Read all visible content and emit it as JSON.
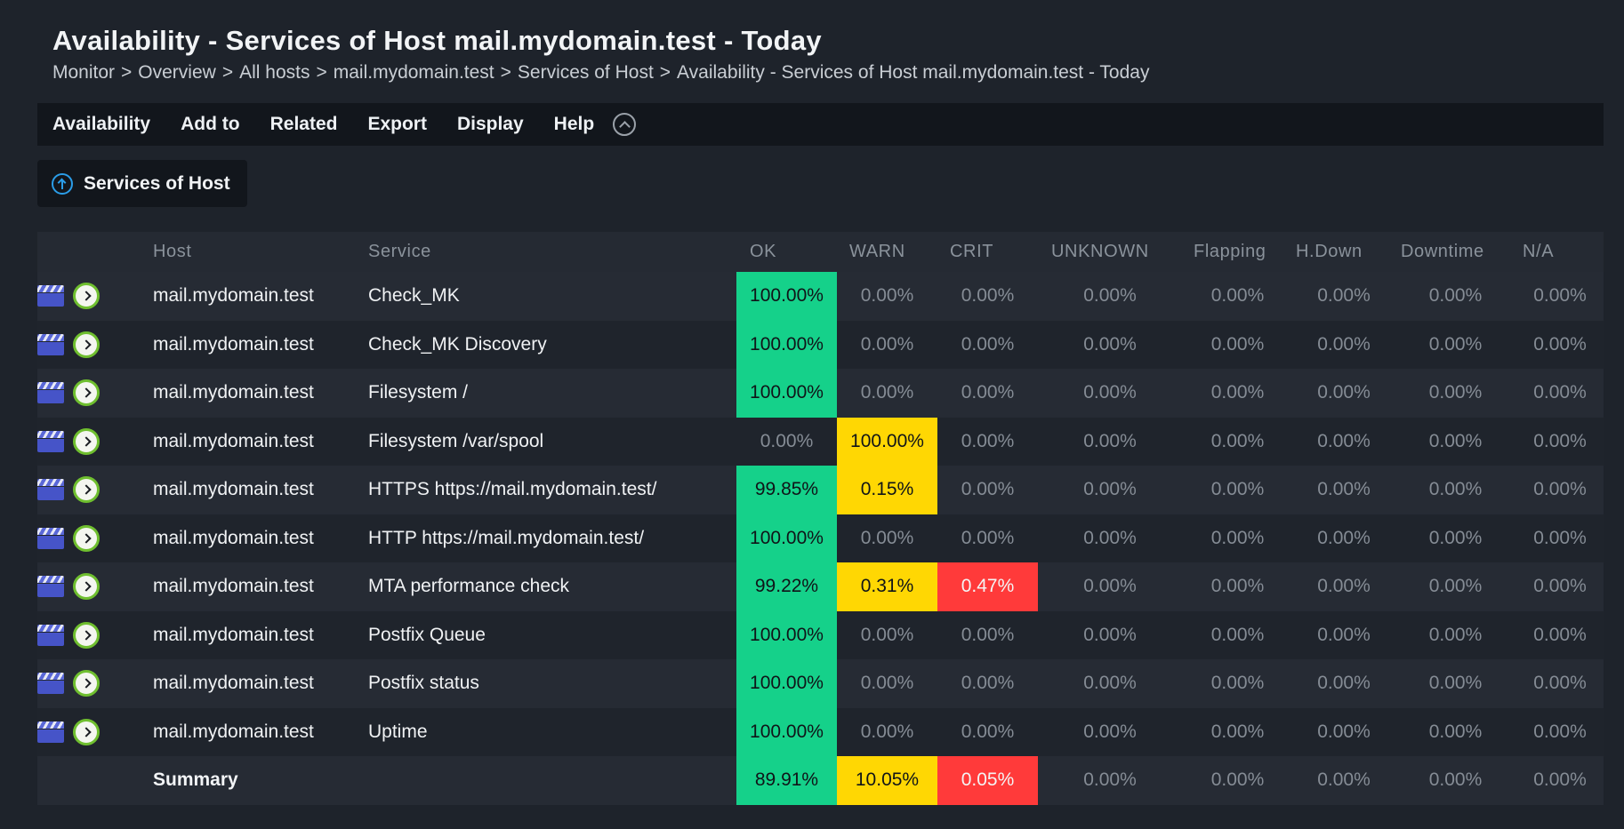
{
  "page": {
    "title": "Availability - Services of Host mail.mydomain.test - Today",
    "breadcrumb": [
      "Monitor",
      "Overview",
      "All hosts",
      "mail.mydomain.test",
      "Services of Host",
      "Availability - Services of Host mail.mydomain.test - Today"
    ],
    "breadcrumb_separator": ">"
  },
  "menubar": {
    "items": [
      "Availability",
      "Add to",
      "Related",
      "Export",
      "Display",
      "Help"
    ],
    "collapse_icon": "chevron-up-circle-icon"
  },
  "context_button": {
    "label": "Services of Host",
    "icon": "arrow-up-circle-icon"
  },
  "colors": {
    "ok": "#15d18a",
    "warn": "#ffd703",
    "crit": "#ff3a3a"
  },
  "table": {
    "columns": [
      "",
      "Host",
      "Service",
      "OK",
      "WARN",
      "CRIT",
      "UNKNOWN",
      "Flapping",
      "H.Down",
      "Downtime",
      "N/A"
    ],
    "rows": [
      {
        "host": "mail.mydomain.test",
        "service": "Check_MK",
        "ok": "100.00%",
        "warn": "0.00%",
        "crit": "0.00%",
        "unknown": "0.00%",
        "flapping": "0.00%",
        "hdown": "0.00%",
        "downtime": "0.00%",
        "na": "0.00%"
      },
      {
        "host": "mail.mydomain.test",
        "service": "Check_MK Discovery",
        "ok": "100.00%",
        "warn": "0.00%",
        "crit": "0.00%",
        "unknown": "0.00%",
        "flapping": "0.00%",
        "hdown": "0.00%",
        "downtime": "0.00%",
        "na": "0.00%"
      },
      {
        "host": "mail.mydomain.test",
        "service": "Filesystem /",
        "ok": "100.00%",
        "warn": "0.00%",
        "crit": "0.00%",
        "unknown": "0.00%",
        "flapping": "0.00%",
        "hdown": "0.00%",
        "downtime": "0.00%",
        "na": "0.00%"
      },
      {
        "host": "mail.mydomain.test",
        "service": "Filesystem /var/spool",
        "ok": "0.00%",
        "warn": "100.00%",
        "crit": "0.00%",
        "unknown": "0.00%",
        "flapping": "0.00%",
        "hdown": "0.00%",
        "downtime": "0.00%",
        "na": "0.00%"
      },
      {
        "host": "mail.mydomain.test",
        "service": "HTTPS https://mail.mydomain.test/",
        "ok": "99.85%",
        "warn": "0.15%",
        "crit": "0.00%",
        "unknown": "0.00%",
        "flapping": "0.00%",
        "hdown": "0.00%",
        "downtime": "0.00%",
        "na": "0.00%"
      },
      {
        "host": "mail.mydomain.test",
        "service": "HTTP https://mail.mydomain.test/",
        "ok": "100.00%",
        "warn": "0.00%",
        "crit": "0.00%",
        "unknown": "0.00%",
        "flapping": "0.00%",
        "hdown": "0.00%",
        "downtime": "0.00%",
        "na": "0.00%"
      },
      {
        "host": "mail.mydomain.test",
        "service": "MTA performance check",
        "ok": "99.22%",
        "warn": "0.31%",
        "crit": "0.47%",
        "unknown": "0.00%",
        "flapping": "0.00%",
        "hdown": "0.00%",
        "downtime": "0.00%",
        "na": "0.00%"
      },
      {
        "host": "mail.mydomain.test",
        "service": "Postfix Queue",
        "ok": "100.00%",
        "warn": "0.00%",
        "crit": "0.00%",
        "unknown": "0.00%",
        "flapping": "0.00%",
        "hdown": "0.00%",
        "downtime": "0.00%",
        "na": "0.00%"
      },
      {
        "host": "mail.mydomain.test",
        "service": "Postfix status",
        "ok": "100.00%",
        "warn": "0.00%",
        "crit": "0.00%",
        "unknown": "0.00%",
        "flapping": "0.00%",
        "hdown": "0.00%",
        "downtime": "0.00%",
        "na": "0.00%"
      },
      {
        "host": "mail.mydomain.test",
        "service": "Uptime",
        "ok": "100.00%",
        "warn": "0.00%",
        "crit": "0.00%",
        "unknown": "0.00%",
        "flapping": "0.00%",
        "hdown": "0.00%",
        "downtime": "0.00%",
        "na": "0.00%"
      }
    ],
    "row_icons": [
      "service-history-icon",
      "service-timeline-icon"
    ],
    "summary": {
      "label": "Summary",
      "ok": "89.91%",
      "warn": "10.05%",
      "crit": "0.05%",
      "unknown": "0.00%",
      "flapping": "0.00%",
      "hdown": "0.00%",
      "downtime": "0.00%",
      "na": "0.00%"
    }
  }
}
